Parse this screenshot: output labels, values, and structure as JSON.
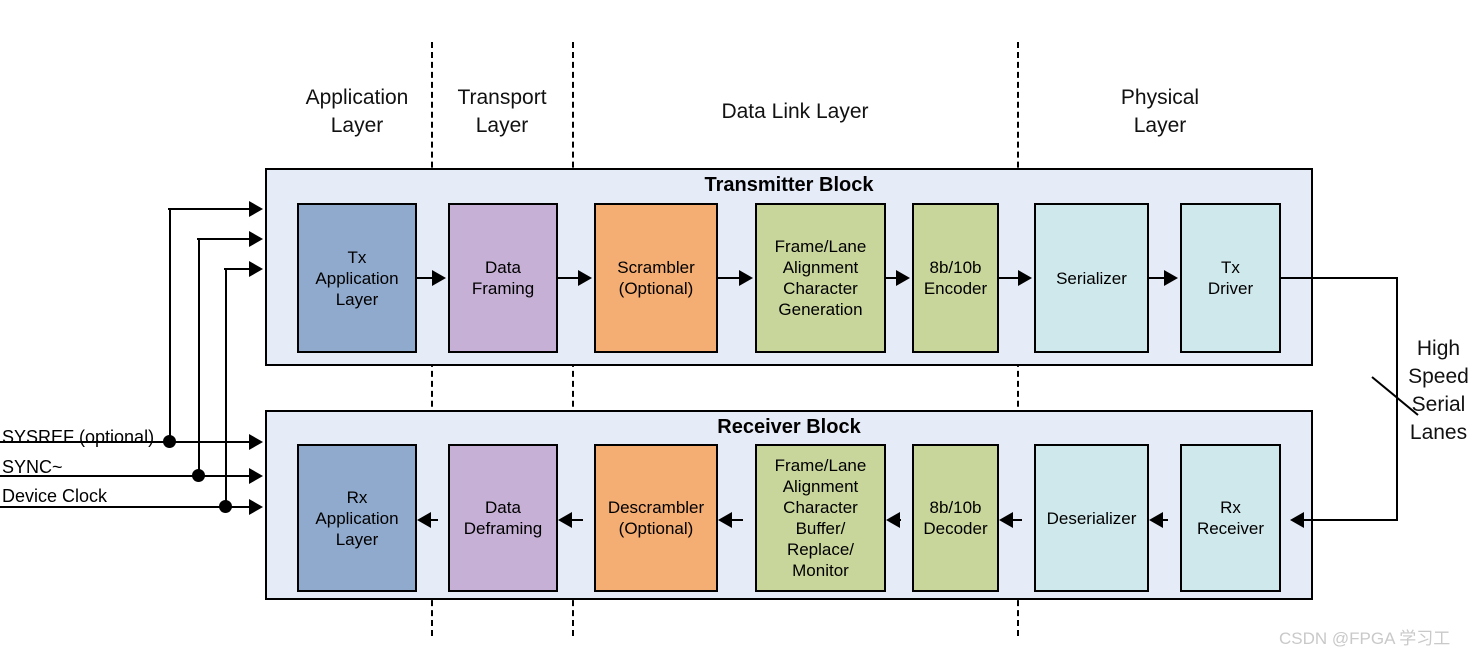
{
  "diagram": {
    "title": "JESD204B Transmitter and Receiver Block Diagram",
    "colors": {
      "panel_bg": "#e6ecf7",
      "application": "#90aacd",
      "transport": "#c7b0d6",
      "scrambler": "#f4ad72",
      "datalink": "#c9d69b",
      "physical": "#cfe8ec",
      "outline": "#000000",
      "watermark": "#c9c9c9"
    }
  },
  "layers": [
    {
      "id": "application",
      "label": "Application\nLayer"
    },
    {
      "id": "transport",
      "label": "Transport\nLayer"
    },
    {
      "id": "datalink",
      "label": "Data Link Layer"
    },
    {
      "id": "physical",
      "label": "Physical\nLayer"
    }
  ],
  "transmitter": {
    "title": "Transmitter Block",
    "flow_direction": "left-to-right",
    "stages": [
      {
        "id": "tx-application-layer",
        "label": "Tx\nApplication\nLayer",
        "color": "application",
        "layer": "application"
      },
      {
        "id": "data-framing",
        "label": "Data\nFraming",
        "color": "transport",
        "layer": "transport"
      },
      {
        "id": "scrambler",
        "label": "Scrambler\n(Optional)",
        "color": "scrambler",
        "layer": "datalink"
      },
      {
        "id": "frame-lane-alignment-generation",
        "label": "Frame/Lane\nAlignment\nCharacter\nGeneration",
        "color": "datalink",
        "layer": "datalink"
      },
      {
        "id": "8b10b-encoder",
        "label": "8b/10b\nEncoder",
        "color": "datalink",
        "layer": "datalink"
      },
      {
        "id": "serializer",
        "label": "Serializer",
        "color": "physical",
        "layer": "physical"
      },
      {
        "id": "tx-driver",
        "label": "Tx\nDriver",
        "color": "physical",
        "layer": "physical"
      }
    ]
  },
  "receiver": {
    "title": "Receiver Block",
    "flow_direction": "right-to-left",
    "stages": [
      {
        "id": "rx-application-layer",
        "label": "Rx\nApplication\nLayer",
        "color": "application",
        "layer": "application"
      },
      {
        "id": "data-deframing",
        "label": "Data\nDeframing",
        "color": "transport",
        "layer": "transport"
      },
      {
        "id": "descrambler",
        "label": "Descrambler\n(Optional)",
        "color": "scrambler",
        "layer": "datalink"
      },
      {
        "id": "frame-lane-alignment-buffer",
        "label": "Frame/Lane\nAlignment\nCharacter\nBuffer/\nReplace/\nMonitor",
        "color": "datalink",
        "layer": "datalink"
      },
      {
        "id": "8b10b-decoder",
        "label": "8b/10b\nDecoder",
        "color": "datalink",
        "layer": "datalink"
      },
      {
        "id": "deserializer",
        "label": "Deserializer",
        "color": "physical",
        "layer": "physical"
      },
      {
        "id": "rx-receiver",
        "label": "Rx\nReceiver",
        "color": "physical",
        "layer": "physical"
      }
    ]
  },
  "input_signals": [
    {
      "id": "sysref",
      "label": "SYSREF (optional)"
    },
    {
      "id": "sync",
      "label": "SYNC~"
    },
    {
      "id": "device-clock",
      "label": "Device Clock"
    }
  ],
  "annotations": {
    "high_speed_serial_lanes": "High\nSpeed\nSerial\nLanes"
  },
  "watermark": {
    "text": "CSDN @FPGA 学习工"
  }
}
